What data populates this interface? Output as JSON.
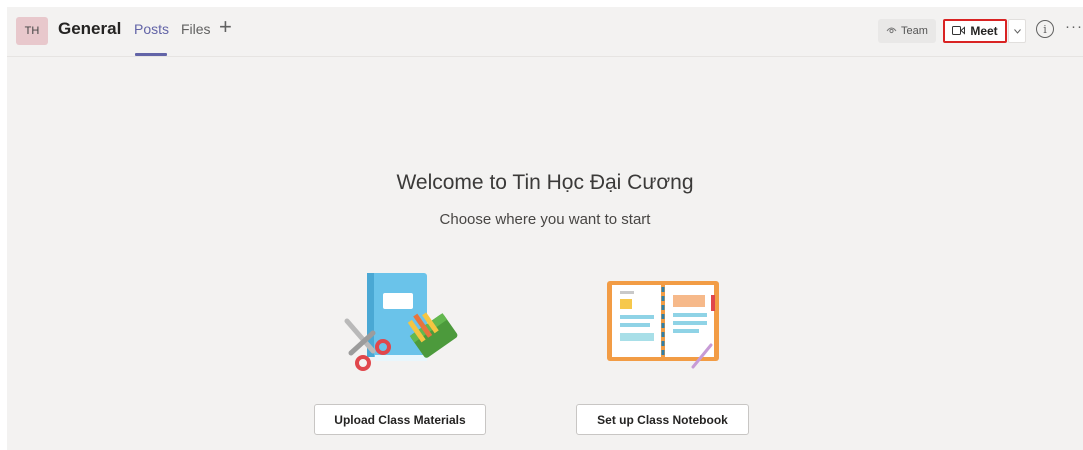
{
  "header": {
    "avatar_initials": "TH",
    "channel_name": "General",
    "tabs": [
      {
        "label": "Posts",
        "active": true
      },
      {
        "label": "Files",
        "active": false
      }
    ],
    "add_tab_icon": "plus-icon",
    "team_button_label": "Team",
    "team_button_icon": "eye-icon",
    "meet_button_label": "Meet",
    "meet_button_icon": "video-camera-icon",
    "meet_dropdown_icon": "chevron-down-icon",
    "info_icon": "info-icon",
    "more_icon": "more-options-icon"
  },
  "main": {
    "welcome_title": "Welcome to Tin Học Đại Cương",
    "subtitle": "Choose where you want to start",
    "cards": [
      {
        "label": "Upload Class Materials",
        "illustration": "notebook-scissors-illustration"
      },
      {
        "label": "Set up Class Notebook",
        "illustration": "open-notebook-illustration"
      }
    ]
  },
  "colors": {
    "accent": "#6264a7",
    "background": "#f3f2f1",
    "highlight_border": "#d92323"
  }
}
